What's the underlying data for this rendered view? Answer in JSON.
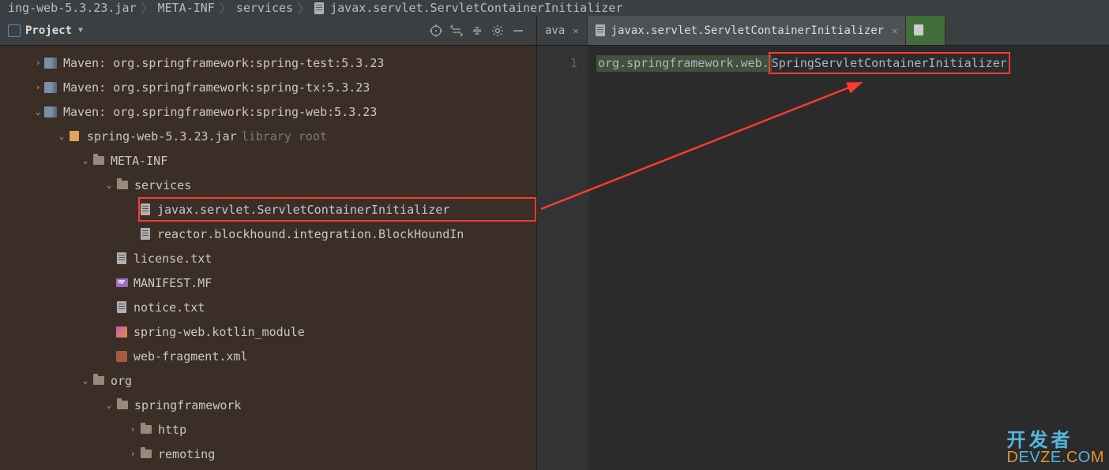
{
  "breadcrumb": {
    "items": [
      "ing-web-5.3.23.jar",
      "META-INF",
      "services",
      "javax.servlet.ServletContainerInitializer"
    ]
  },
  "sidebar": {
    "title": "Project"
  },
  "tree": {
    "maven_test": "Maven: org.springframework:spring-test:5.3.23",
    "maven_tx": "Maven: org.springframework:spring-tx:5.3.23",
    "maven_web": "Maven: org.springframework:spring-web:5.3.23",
    "jar": "spring-web-5.3.23.jar",
    "jar_hint": "library root",
    "metainf": "META-INF",
    "services": "services",
    "sci": "javax.servlet.ServletContainerInitializer",
    "reactor": "reactor.blockhound.integration.BlockHoundIn",
    "license": "license.txt",
    "manifest": "MANIFEST.MF",
    "notice": "notice.txt",
    "kotlin": "spring-web.kotlin_module",
    "webfrag": "web-fragment.xml",
    "org": "org",
    "springfw": "springframework",
    "http": "http",
    "remoting": "remoting"
  },
  "tabs": {
    "tab1": "ava",
    "tab2": "javax.servlet.ServletContainerInitializer"
  },
  "editor": {
    "gutter_1": "1",
    "line1_a": "org.springframework.web.",
    "line1_b": "SpringServletContainerInitializer"
  },
  "watermark": {
    "line1": "开发者",
    "line2_a": "D",
    "line2_b": "EV",
    "line2_c": "Z",
    "line2_d": "E.",
    "line2_e": "C",
    "line2_f": "O",
    "line2_g": "M"
  }
}
